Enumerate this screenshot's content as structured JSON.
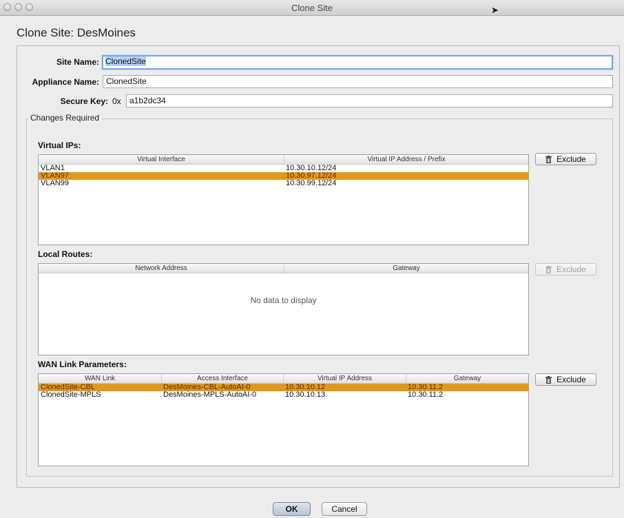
{
  "window": {
    "title": "Clone Site"
  },
  "dialog": {
    "heading": "Clone Site: DesMoines"
  },
  "form": {
    "site_name_label": "Site Name:",
    "site_name_value": "ClonedSite",
    "appliance_name_label": "Appliance Name:",
    "appliance_name_value": "ClonedSite",
    "secure_key_label": "Secure Key:",
    "secure_key_prefix": "0x",
    "secure_key_value": "a1b2dc34"
  },
  "changes": {
    "legend": "Changes Required",
    "virtual_ips": {
      "title": "Virtual IPs:",
      "columns": [
        "Virtual Interface",
        "Virtual IP Address / Prefix"
      ],
      "rows": [
        [
          "VLAN1",
          "10.30.10.12/24"
        ],
        [
          "VLAN97",
          "10.30.97.12/24"
        ],
        [
          "VLAN99",
          "10.30.99.12/24"
        ]
      ],
      "selected_row": 1,
      "exclude_label": "Exclude"
    },
    "local_routes": {
      "title": "Local Routes:",
      "columns": [
        "Network Address",
        "Gateway"
      ],
      "empty_text": "No data to display",
      "exclude_label": "Exclude"
    },
    "wan_links": {
      "title": "WAN Link Parameters:",
      "columns": [
        "WAN Link",
        "Access Interface",
        "Virtual IP Address",
        "Gateway"
      ],
      "rows": [
        [
          "ClonedSite-CBL",
          "DesMoines-CBL-AutoAI-0",
          "10.30.10.12",
          "10.30.11.2"
        ],
        [
          "ClonedSite-MPLS",
          "DesMoines-MPLS-AutoAI-0",
          "10.30.10.13",
          "10.30.11.2"
        ]
      ],
      "selected_row": 0,
      "exclude_label": "Exclude"
    }
  },
  "footer": {
    "ok_label": "OK",
    "cancel_label": "Cancel"
  },
  "colors": {
    "selection": "#e0991c",
    "text_selection": "#b3d2f5",
    "focus_ring": "#7aa7e0"
  }
}
